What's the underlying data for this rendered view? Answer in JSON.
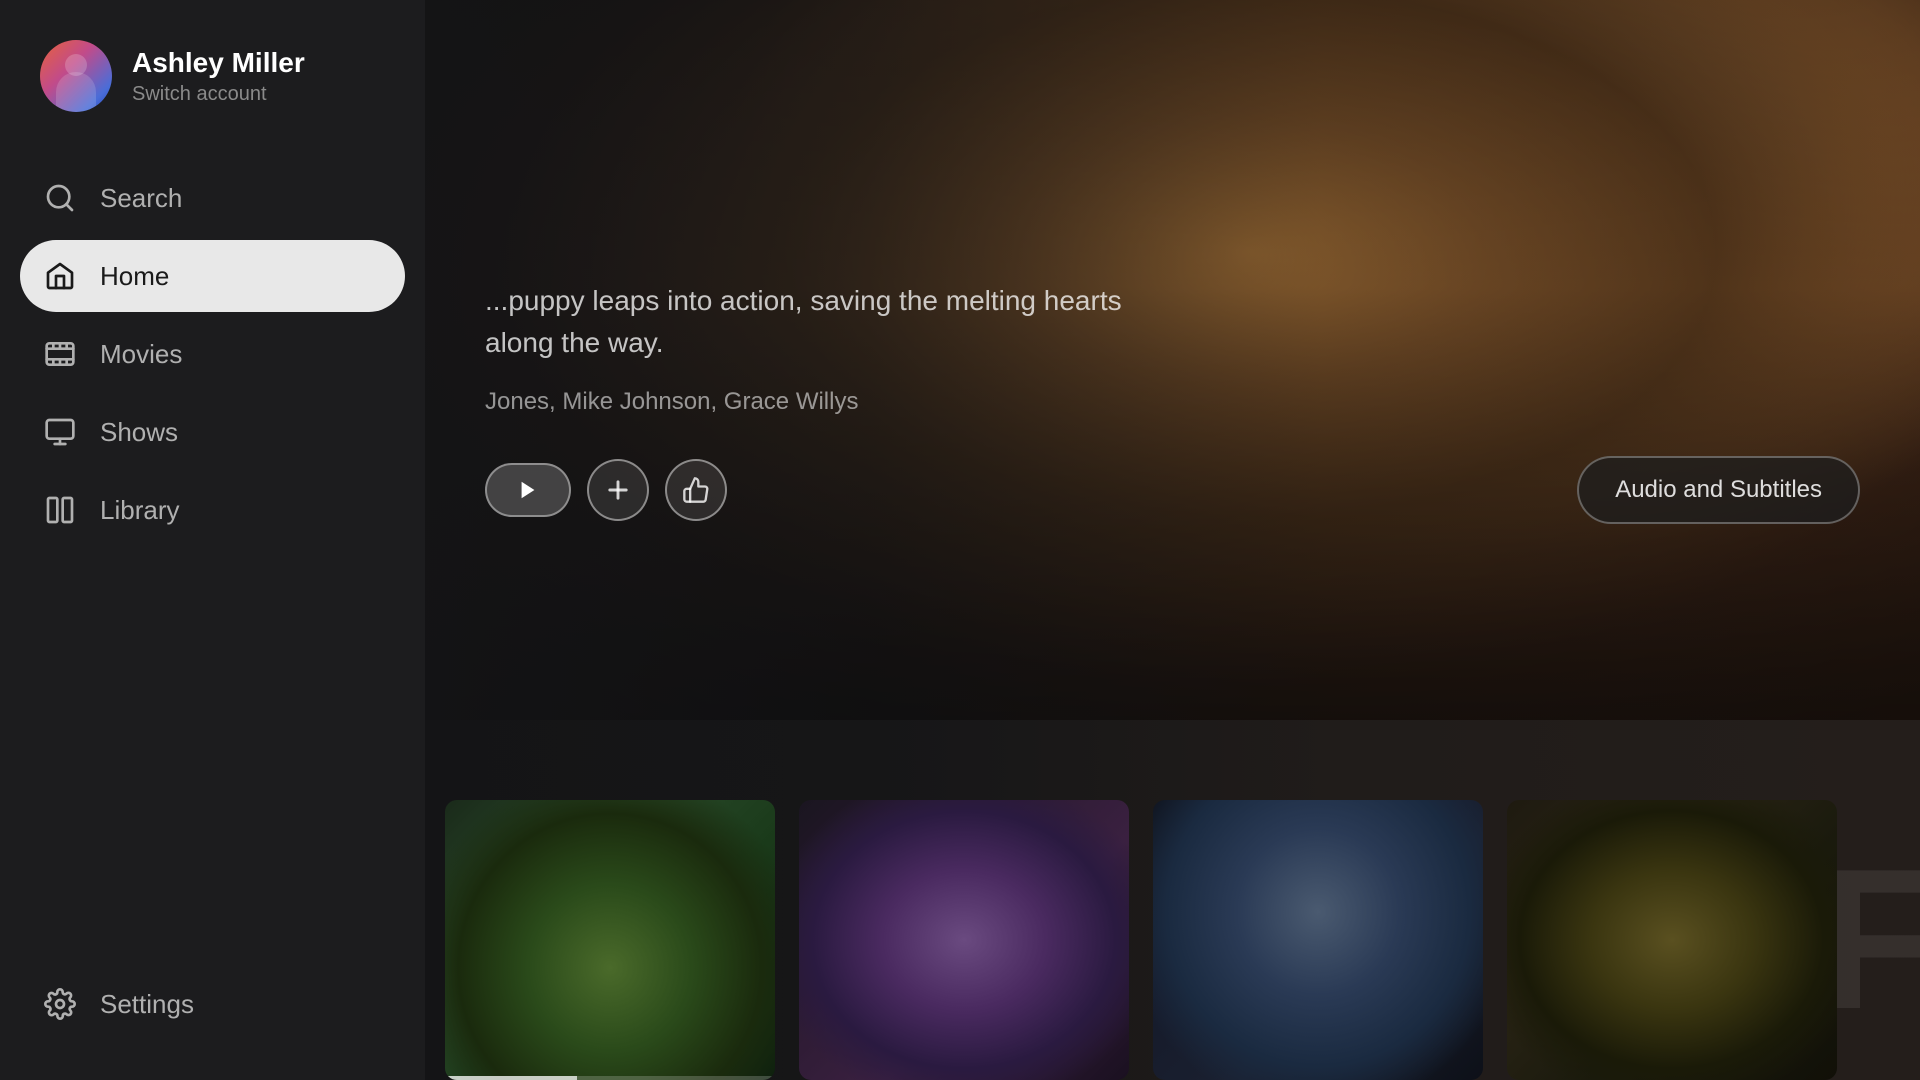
{
  "user": {
    "name": "Ashley Miller",
    "switch_label": "Switch account"
  },
  "nav": {
    "items": [
      {
        "id": "search",
        "label": "Search",
        "icon": "search"
      },
      {
        "id": "home",
        "label": "Home",
        "icon": "home",
        "active": true
      },
      {
        "id": "movies",
        "label": "Movies",
        "icon": "movies"
      },
      {
        "id": "shows",
        "label": "Shows",
        "icon": "shows"
      },
      {
        "id": "library",
        "label": "Library",
        "icon": "library"
      }
    ],
    "settings": {
      "id": "settings",
      "label": "Settings",
      "icon": "settings"
    }
  },
  "hero": {
    "description": "...puppy leaps into action, saving the melting hearts along the way.",
    "cast": "Jones, Mike Johnson, Grace Willys",
    "buttons": {
      "add_label": "+",
      "like_label": "👍",
      "audio_subtitles_label": "Audio and Subtitles"
    }
  },
  "thumbnails": [
    {
      "id": "thumb1",
      "progress": 40
    },
    {
      "id": "thumb2",
      "progress": 0
    },
    {
      "id": "thumb3",
      "progress": 0
    },
    {
      "id": "thumb4",
      "progress": 0
    }
  ],
  "colors": {
    "sidebar_bg": "#1c1c1e",
    "active_nav_bg": "#e8e8e8",
    "active_nav_text": "#1a1a1a",
    "inactive_nav_text": "#b0b0b0"
  }
}
